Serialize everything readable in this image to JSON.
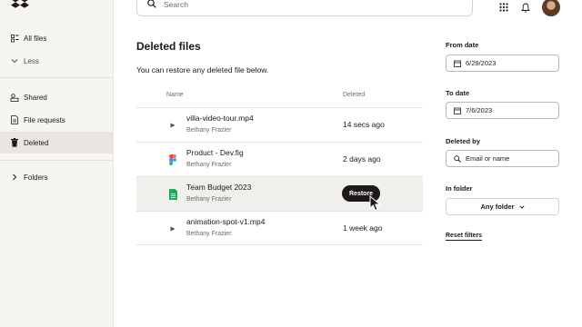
{
  "sidebar": {
    "items": [
      {
        "label": "All files",
        "icon": "all-files-icon"
      },
      {
        "label": "Less",
        "icon": "chevron-down-icon"
      },
      {
        "label": "Shared",
        "icon": "shared-icon"
      },
      {
        "label": "File requests",
        "icon": "file-request-icon"
      },
      {
        "label": "Deleted",
        "icon": "trash-icon",
        "active": true
      },
      {
        "label": "Folders",
        "icon": "chevron-right-icon"
      }
    ]
  },
  "search": {
    "placeholder": "Search"
  },
  "main": {
    "title": "Deleted files",
    "subtitle": "You can restore any deleted file below.",
    "columns": {
      "name": "Name",
      "deleted": "Deleted"
    },
    "rows": [
      {
        "name": "villa-video-tour.mp4",
        "owner": "Bethany Frazier",
        "deleted": "14 secs ago",
        "type": "video"
      },
      {
        "name": "Product - Dev.fig",
        "owner": "Bethany Frazier",
        "deleted": "2 days ago",
        "type": "figma"
      },
      {
        "name": "Team Budget 2023",
        "owner": "Bethany Frazier",
        "deleted": "",
        "type": "sheet",
        "hovered": true
      },
      {
        "name": "animation-spot-v1.mp4",
        "owner": "Bethany Frazier",
        "deleted": "1 week ago",
        "type": "video"
      }
    ],
    "restore_label": "Restore"
  },
  "filters": {
    "from_label": "From date",
    "from_value": "6/29/2023",
    "to_label": "To date",
    "to_value": "7/6/2023",
    "deleted_by_label": "Deleted by",
    "deleted_by_placeholder": "Email or name",
    "in_folder_label": "In folder",
    "in_folder_value": "Any folder",
    "reset_label": "Reset filters"
  },
  "colors": {
    "accent": "#1e1919",
    "sidebar_bg": "#f7f5f2",
    "sheet_green": "#1faa59"
  }
}
